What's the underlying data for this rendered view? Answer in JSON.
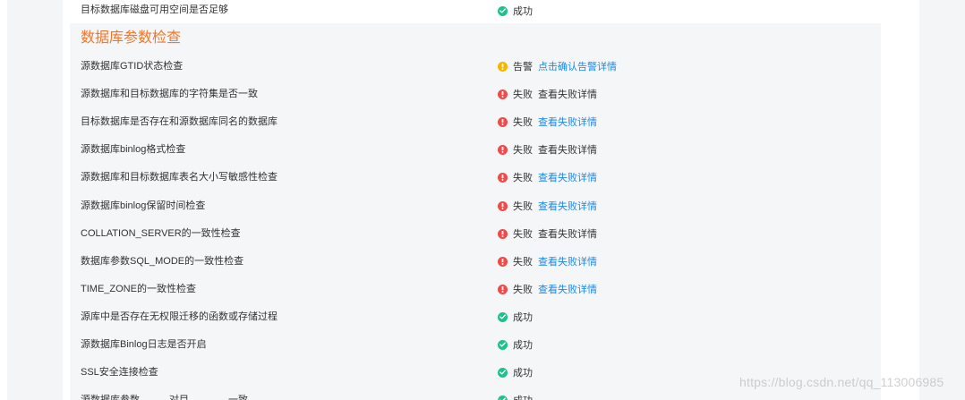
{
  "top_row": {
    "name": "目标数据库磁盘可用空间是否足够",
    "status": "成功"
  },
  "section": {
    "title": "数据库参数检查"
  },
  "rows": [
    {
      "name": "源数据库GTID状态检查",
      "status": "告警",
      "detail": "点击确认告警详情"
    },
    {
      "name": "源数据库和目标数据库的字符集是否一致",
      "status": "失败",
      "detail": "查看失败详情"
    },
    {
      "name": "目标数据库是否存在和源数据库同名的数据库",
      "status": "失败",
      "detail": "查看失败详情"
    },
    {
      "name": "源数据库binlog格式检查",
      "status": "失败",
      "detail": "查看失败详情"
    },
    {
      "name": "源数据库和目标数据库表名大小写敏感性检查",
      "status": "失败",
      "detail": "查看失败详情"
    },
    {
      "name": "源数据库binlog保留时间检查",
      "status": "失败",
      "detail": "查看失败详情"
    },
    {
      "name": "COLLATION_SERVER的一致性检查",
      "status": "失败",
      "detail": "查看失败详情"
    },
    {
      "name": "数据库参数SQL_MODE的一致性检查",
      "status": "失败",
      "detail": "查看失败详情"
    },
    {
      "name": "TIME_ZONE的一致性检查",
      "status": "失败",
      "detail": "查看失败详情"
    },
    {
      "name": "源库中是否存在无权限迁移的函数或存储过程",
      "status": "成功"
    },
    {
      "name": "源数据库Binlog日志是否开启",
      "status": "成功"
    },
    {
      "name": "SSL安全连接检查",
      "status": "成功"
    },
    {
      "name": "源数据库参数………对目…………一致",
      "status": "成功"
    }
  ],
  "watermark": "https://blog.csdn.net/qq_113006985",
  "colors": {
    "section_title": "#f0772c",
    "success": "#1cc18c",
    "warning": "#f7b500",
    "fail": "#f04a4a",
    "link": "#1e88e5"
  }
}
